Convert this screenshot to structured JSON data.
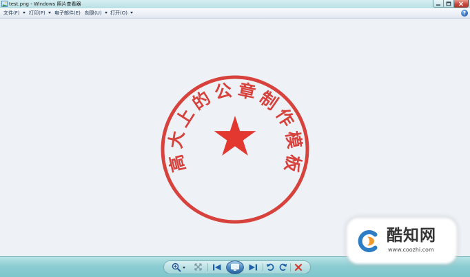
{
  "window": {
    "title": "test.png - Windows 照片查看器",
    "app_icon": "photo-viewer-icon",
    "controls": [
      "minimize-icon",
      "maximize-icon",
      "close-icon"
    ]
  },
  "menu": {
    "items": [
      {
        "label": "文件(F)",
        "has_dropdown": true
      },
      {
        "label": "打印(P)",
        "has_dropdown": true
      },
      {
        "label": "电子邮件(E)",
        "has_dropdown": false
      },
      {
        "label": "刻录(U)",
        "has_dropdown": true
      },
      {
        "label": "打开(O)",
        "has_dropdown": true
      }
    ],
    "help_label": "?"
  },
  "viewer": {
    "seal": {
      "text": "高大上的公章制作模板",
      "center_icon": "star-icon"
    }
  },
  "watermark": {
    "brand": "酷知网",
    "url": "www.coozhi.com",
    "logo_icon": "coozhi-logo-icon"
  },
  "toolbar": {
    "buttons": [
      "zoom-icon",
      "actual-size-icon",
      "previous-icon",
      "slideshow-icon",
      "next-icon",
      "rotate-counterclockwise-icon",
      "rotate-clockwise-icon",
      "delete-icon"
    ]
  },
  "colors": {
    "title_bar": "#b9e0e4",
    "toolbar": "#8ccdd2",
    "viewer_background": "#eef2f7",
    "seal": "#d7423d",
    "star": "#e2382f",
    "close_button": "#c8463b",
    "delete": "#d23a2f",
    "accent_icon": "#1f5fa6"
  }
}
